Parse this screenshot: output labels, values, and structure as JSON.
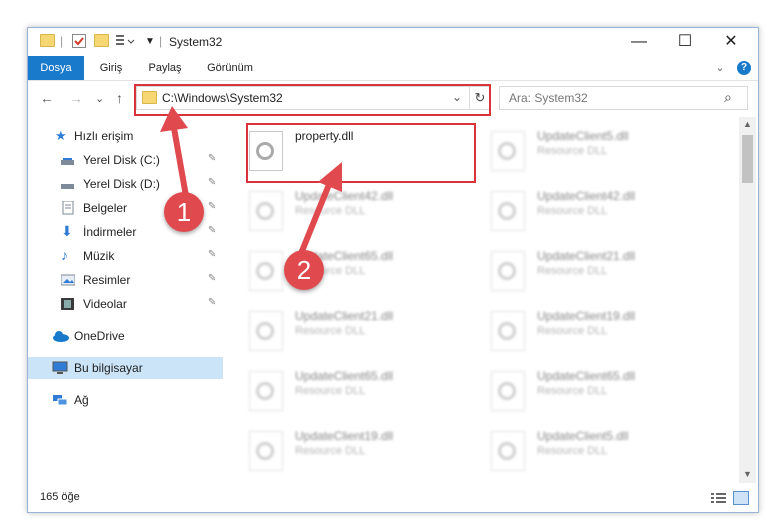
{
  "window": {
    "title": "System32",
    "minimize_glyph": "—",
    "maximize_glyph": "☐",
    "close_glyph": "✕"
  },
  "ribbon": {
    "tabs": [
      "Dosya",
      "Giriş",
      "Paylaş",
      "Görünüm"
    ],
    "active_tab": "Dosya",
    "collapse_glyph": "⌄",
    "help_glyph": "?"
  },
  "nav": {
    "back_glyph": "←",
    "forward_glyph": "→",
    "recent_glyph": "⌄",
    "up_glyph": "↑",
    "address": "C:\\Windows\\System32",
    "address_dropdown_glyph": "⌄",
    "refresh_glyph": "↻",
    "search_placeholder": "Ara: System32",
    "search_glyph": "⌕"
  },
  "sidebar": {
    "items": [
      {
        "label": "Hızlı erişim",
        "icon": "star-icon",
        "pinned": false
      },
      {
        "label": "Yerel Disk (C:)",
        "icon": "drive-icon",
        "pinned": true
      },
      {
        "label": "Yerel Disk (D:)",
        "icon": "drive-icon",
        "pinned": true
      },
      {
        "label": "Belgeler",
        "icon": "documents-icon",
        "pinned": true
      },
      {
        "label": "İndirmeler",
        "icon": "download-icon",
        "pinned": true
      },
      {
        "label": "Müzik",
        "icon": "music-icon",
        "pinned": true
      },
      {
        "label": "Resimler",
        "icon": "pictures-icon",
        "pinned": true
      },
      {
        "label": "Videolar",
        "icon": "videos-icon",
        "pinned": true
      },
      {
        "label": "OneDrive",
        "icon": "cloud-icon",
        "pinned": false
      },
      {
        "label": "Bu bilgisayar",
        "icon": "computer-icon",
        "pinned": false,
        "selected": true
      },
      {
        "label": "Ağ",
        "icon": "network-icon",
        "pinned": false
      }
    ],
    "pin_glyph": "📌"
  },
  "files": {
    "highlighted": {
      "name": "property.dll"
    },
    "items": [
      {
        "name": "UpdateClient5.dll",
        "type": "Resource DLL"
      },
      {
        "name": "UpdateClient42.dll",
        "type": "Resource DLL"
      },
      {
        "name": "UpdateClient42.dll",
        "type": "Resource DLL"
      },
      {
        "name": "UpdateClient65.dll",
        "type": "Resource DLL"
      },
      {
        "name": "UpdateClient21.dll",
        "type": "Resource DLL"
      },
      {
        "name": "UpdateClient21.dll",
        "type": "Resource DLL"
      },
      {
        "name": "UpdateClient19.dll",
        "type": "Resource DLL"
      },
      {
        "name": "UpdateClient65.dll",
        "type": "Resource DLL"
      },
      {
        "name": "UpdateClient65.dll",
        "type": "Resource DLL"
      },
      {
        "name": "UpdateClient19.dll",
        "type": "Resource DLL"
      },
      {
        "name": "UpdateClient5.dll",
        "type": "Resource DLL"
      }
    ]
  },
  "status": {
    "item_count": "165 öğe"
  },
  "callouts": [
    "1",
    "2"
  ],
  "colors": {
    "accent": "#1979ca",
    "highlight_border": "#d9343a",
    "callout": "#e04a4f"
  }
}
